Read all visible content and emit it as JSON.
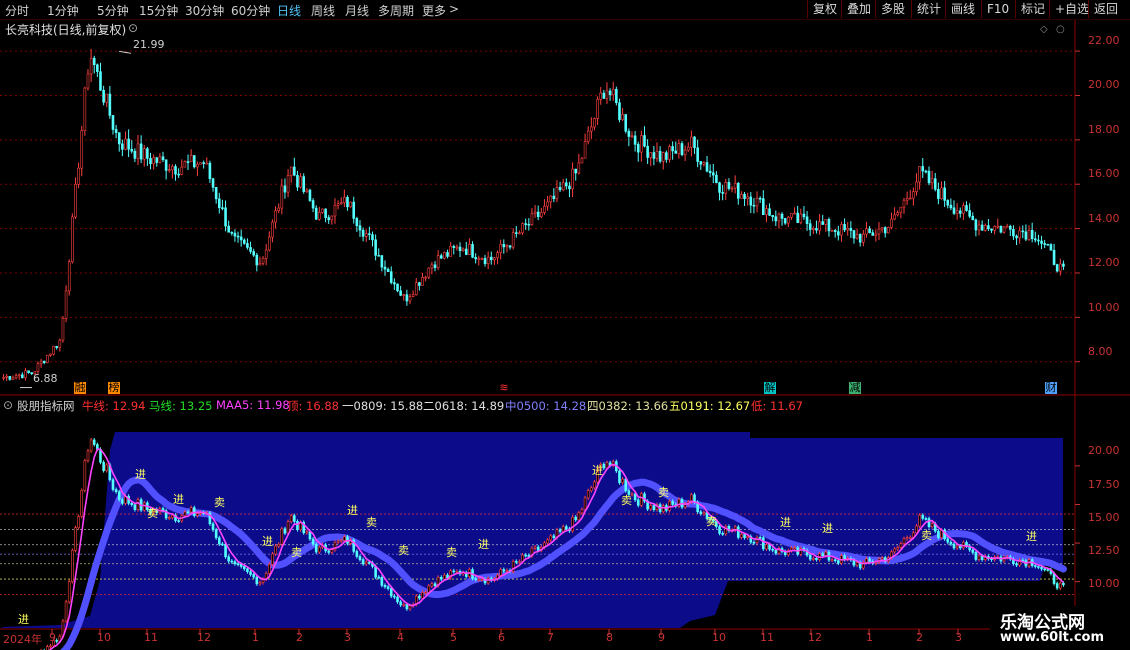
{
  "toolbar": {
    "periods": [
      "分时",
      "1分钟",
      "5分钟",
      "15分钟",
      "30分钟",
      "60分钟",
      "日线",
      "周线",
      "月线",
      "多周期",
      "更多"
    ],
    "active_period": "日线",
    "more_arrow": ">",
    "right_buttons": [
      "复权",
      "叠加",
      "多股",
      "统计",
      "画线",
      "F10",
      "标记",
      "+自选",
      "返回"
    ]
  },
  "main_chart": {
    "title": "长亮科技(日线,前复权)",
    "high_label": "21.99",
    "low_label": "6.88",
    "y_ticks": [
      "22.00",
      "20.00",
      "18.00",
      "16.00",
      "14.00",
      "12.00",
      "10.00",
      "8.00"
    ],
    "event_badges": [
      {
        "text": "融",
        "color": "#ff8c00"
      },
      {
        "text": "榜",
        "color": "#ff8c00"
      },
      {
        "text": "≋",
        "color": "#ff3030"
      },
      {
        "text": "解",
        "color": "#00c8c8"
      },
      {
        "text": "减",
        "color": "#3cb371"
      },
      {
        "text": "财",
        "color": "#4fa3ff"
      }
    ]
  },
  "indicator": {
    "name": "股朋指标网",
    "items": [
      {
        "label": "牛线: 12.94",
        "color": "#ff3030"
      },
      {
        "label": "马线: 13.25",
        "color": "#22dd22"
      },
      {
        "label": "MAA5: 11.98",
        "color": "#ff44ff"
      },
      {
        "label": "顶: 16.88",
        "color": "#ff3030"
      },
      {
        "label": "一0809: 15.88",
        "color": "#e0e0e0"
      },
      {
        "label": "二0618: 14.89",
        "color": "#e0e0e0"
      },
      {
        "label": "中0500: 14.28",
        "color": "#8080ff"
      },
      {
        "label": "四0382: 13.66",
        "color": "#e0e0a0"
      },
      {
        "label": "五0191: 12.67",
        "color": "#ffff60"
      },
      {
        "label": "低: 11.67",
        "color": "#ff3030"
      }
    ],
    "y_ticks": [
      "20.00",
      "17.50",
      "15.00",
      "12.50",
      "10.00"
    ],
    "signal_buy": "进",
    "signal_sell": "卖"
  },
  "time_axis": {
    "year_label": "2024年",
    "months": [
      "9",
      "10",
      "11",
      "12",
      "1",
      "2",
      "3",
      "4",
      "5",
      "6",
      "7",
      "8",
      "9",
      "10",
      "11",
      "12",
      "1",
      "2",
      "3"
    ]
  },
  "watermark": {
    "line1": "乐淘公式网",
    "line2": "www.60lt.com"
  },
  "chart_data": {
    "type": "line",
    "title": "长亮科技(日线,前复权)",
    "xlabel": "",
    "ylabel": "",
    "ylim": [
      6.5,
      22.5
    ],
    "x": [
      "2024-08",
      "2024-09",
      "2024-10",
      "2024-10",
      "2024-11",
      "2024-11",
      "2024-12",
      "2024-12",
      "2025-01",
      "2025-01",
      "2025-02",
      "2025-02",
      "2025-03",
      "2025-03",
      "2025-04",
      "2025-04",
      "2025-05",
      "2025-05",
      "2025-06",
      "2025-06",
      "2025-07",
      "2025-07",
      "2025-08",
      "2025-08",
      "2025-09",
      "2025-09",
      "2025-10",
      "2025-10",
      "2025-11",
      "2025-11",
      "2025-12",
      "2025-12",
      "2026-01",
      "2026-01",
      "2026-02",
      "2026-02",
      "2026-03",
      "2026-03"
    ],
    "series": [
      {
        "name": "",
        "values": [
          7.3,
          7.5,
          9.0,
          21.99,
          18.0,
          17.2,
          16.8,
          17.0,
          13.5,
          12.5,
          16.8,
          14.5,
          15.2,
          13.0,
          10.8,
          12.5,
          13.2,
          12.6,
          13.8,
          15.0,
          16.5,
          20.5,
          18.0,
          17.2,
          17.8,
          16.0,
          15.5,
          14.5,
          14.3,
          14.0,
          13.6,
          14.2,
          16.5,
          15.2,
          14.2,
          14.0,
          13.8,
          12.0
        ]
      }
    ],
    "annotations": [
      "21.99",
      "6.88"
    ],
    "indicator_ylim": [
      9.5,
      22.0
    ],
    "indicator_levels": [
      {
        "name": "顶",
        "value": 16.88
      },
      {
        "name": "一0809",
        "value": 15.88
      },
      {
        "name": "二0618",
        "value": 14.89
      },
      {
        "name": "中0500",
        "value": 14.28
      },
      {
        "name": "四0382",
        "value": 13.66
      },
      {
        "name": "五0191",
        "value": 12.67
      },
      {
        "name": "低",
        "value": 11.67
      }
    ]
  }
}
